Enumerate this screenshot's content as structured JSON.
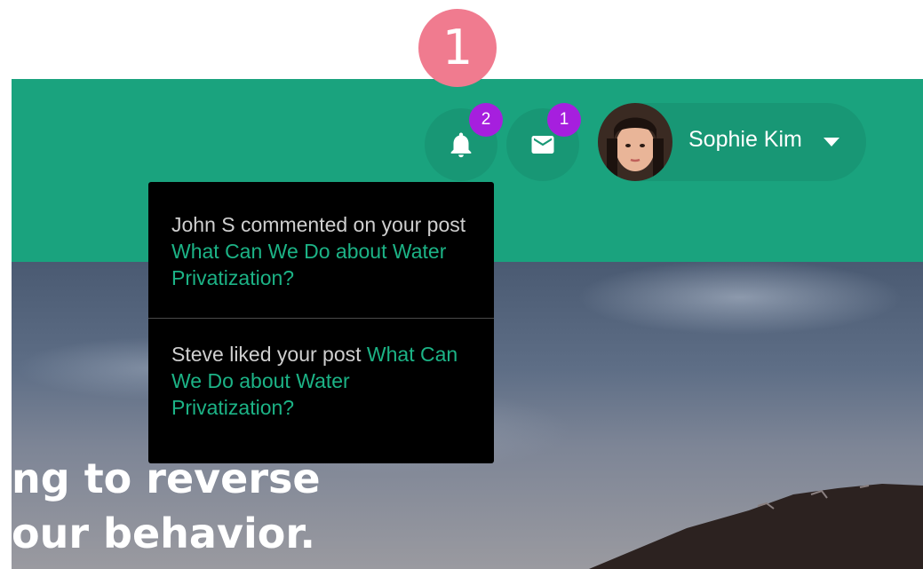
{
  "annotation": {
    "marker_number": "1"
  },
  "header": {
    "background_color": "#1aa37e",
    "notifications": {
      "icon": "bell-icon",
      "badge_count": "2"
    },
    "messages": {
      "icon": "envelope-icon",
      "badge_count": "1"
    },
    "user": {
      "name": "Sophie Kim",
      "avatar": "avatar-photo",
      "menu_icon": "caret-down-icon"
    }
  },
  "notifications_dropdown": {
    "items": [
      {
        "prefix": "John S commented on your post ",
        "link": "What Can We Do about Water Privatization?"
      },
      {
        "prefix": "Steve liked your post ",
        "link": "What Can We Do about Water Privatization?"
      }
    ],
    "link_color": "#1cb386"
  },
  "hero": {
    "headline_line1": "ng to reverse",
    "headline_line2": "our behavior."
  },
  "colors": {
    "badge": "#a61fde",
    "marker": "#f07b8f"
  }
}
